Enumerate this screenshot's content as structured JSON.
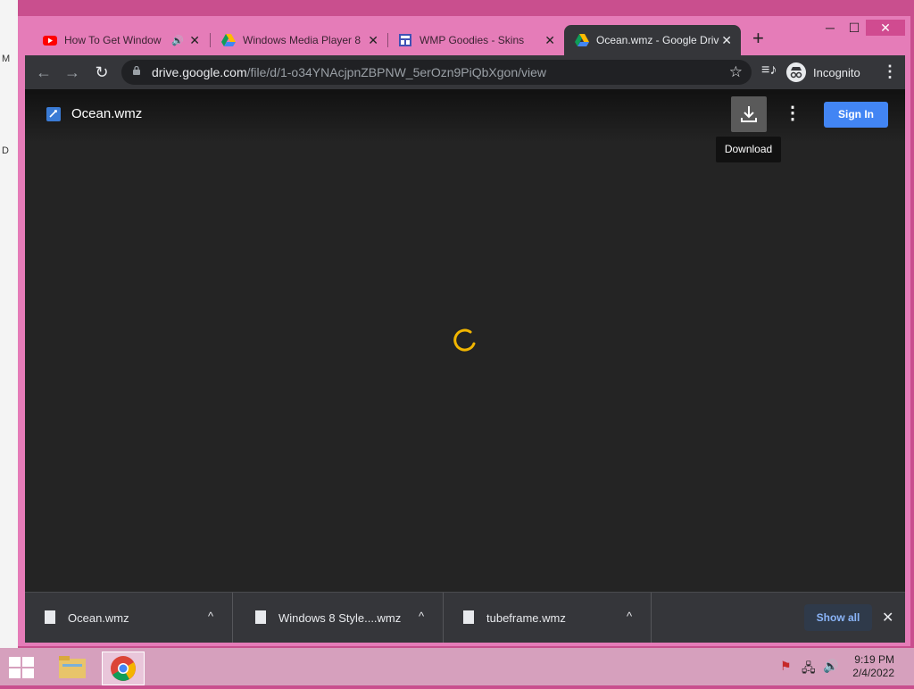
{
  "desktop": {
    "edge_letters": [
      "M",
      "D"
    ]
  },
  "window_controls": {
    "minimize": "─",
    "maximize": "☐",
    "close": "✕"
  },
  "tabs": [
    {
      "title": "How To Get Window",
      "icon": "youtube-icon",
      "audio": "🔊"
    },
    {
      "title": "Windows Media Player 8",
      "icon": "google-drive-icon"
    },
    {
      "title": "WMP Goodies - Skins",
      "icon": "site-icon"
    },
    {
      "title": "Ocean.wmz - Google Drive",
      "icon": "google-drive-icon",
      "active": true
    }
  ],
  "tab_close_glyph": "✕",
  "new_tab_glyph": "+",
  "toolbar": {
    "back": "←",
    "forward": "→",
    "reload": "↻",
    "url_host": "drive.google.com",
    "url_path": "/file/d/1-o34YNAcjpnZBPNW_5erOzn9PiQbXgon/view",
    "star": "☆",
    "media_control": "≡♪",
    "profile_label": "Incognito",
    "menu": "⋮"
  },
  "viewer": {
    "file_name": "Ocean.wmz",
    "more": "⋮",
    "sign_in": "Sign In",
    "download_tooltip": "Download"
  },
  "downloads": {
    "items": [
      {
        "name": "Ocean.wmz",
        "chevron": "^"
      },
      {
        "name": "Windows 8 Style....wmz",
        "chevron": "^"
      },
      {
        "name": "tubeframe.wmz",
        "chevron": "^"
      }
    ],
    "show_all": "Show all",
    "close": "✕"
  },
  "taskbar": {
    "time": "9:19 PM",
    "date": "2/4/2022"
  },
  "colors": {
    "accent": "#4285f4",
    "spinner": "#f2b600",
    "frame": "#e57cb8"
  }
}
